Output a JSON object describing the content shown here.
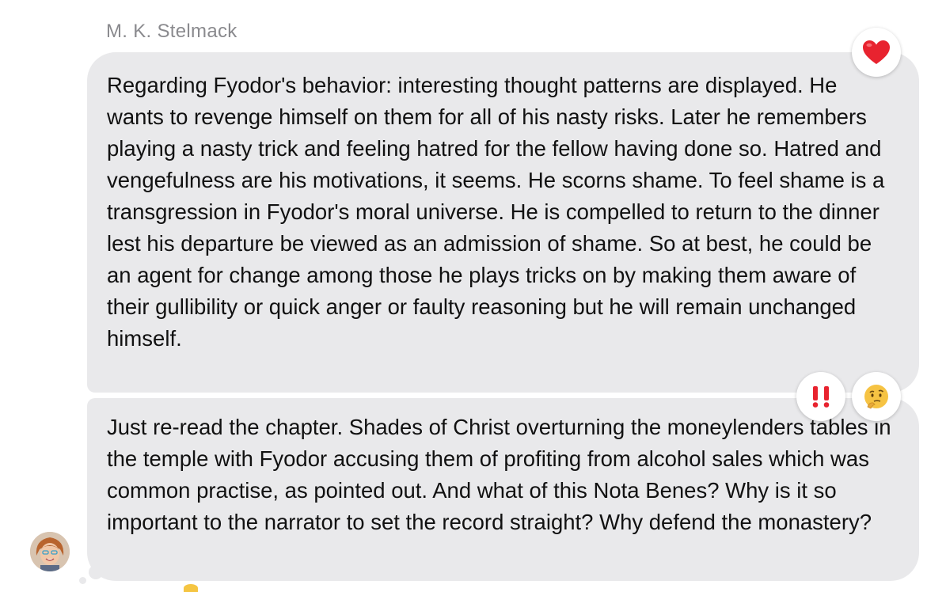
{
  "conversation": {
    "sender_name": "M. K. Stelmack",
    "messages": [
      {
        "text": "Regarding Fyodor's behavior: interesting thought patterns are displayed. He wants to revenge himself on them for all of his nasty risks. Later he remembers playing a nasty trick and feeling hatred for the fellow having done so. Hatred and vengefulness are his motivations, it seems. He scorns shame. To feel shame is a transgression in Fyodor's moral universe. He is compelled to return to the dinner lest his departure be viewed as an admission of shame. So at best, he could be an agent for change among those he plays tricks on by making them aware of their gullibility or quick anger or faulty reasoning but he will remain unchanged himself.",
        "reactions": [
          "heart-icon"
        ]
      },
      {
        "text": "Just re-read the chapter. Shades of Christ overturning the moneylenders tables in the temple with Fyodor accusing them of profiting from alcohol sales which was common practise, as pointed out. And what of this Nota Benes? Why is it so important to the narrator to set the record straight? Why defend the monastery?",
        "reactions": [
          "double-exclamation-icon",
          "thinking-face-icon"
        ]
      }
    ]
  },
  "colors": {
    "bubble_background": "#e9e9eb",
    "sender_name": "#8a8a8e",
    "heart": "#e8232f",
    "exclamation": "#e8232f",
    "thinking_face": "#f6c343"
  }
}
